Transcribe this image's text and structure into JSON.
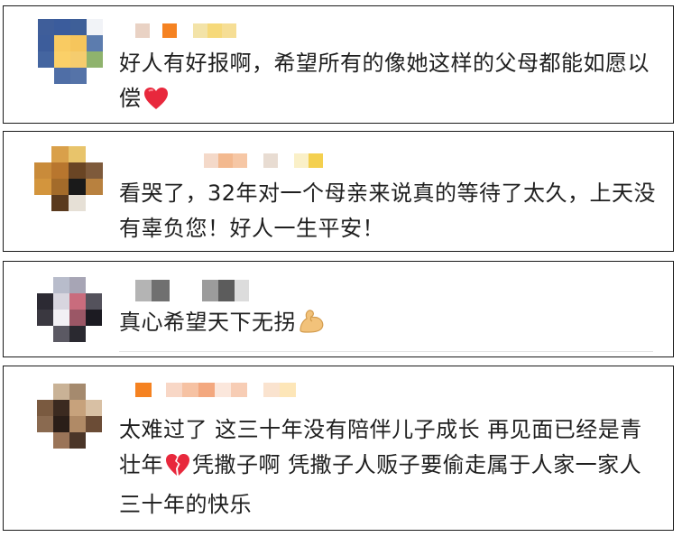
{
  "comments": [
    {
      "text_before": "好人有好报啊，希望所有的像她这样的父母都能如愿以偿",
      "emoji": "red-heart-icon",
      "text_after": ""
    },
    {
      "text_before": "看哭了，32年对一个母亲来说真的等待了太久，上天没有辜负您！好人一生平安！",
      "emoji": "",
      "text_after": ""
    },
    {
      "text_before": "真心希望天下无拐",
      "emoji": "flexed-biceps-icon",
      "text_after": ""
    },
    {
      "text_before": "太难过了 这三十年没有陪伴儿子成长 再见面已经是青壮年",
      "emoji": "broken-heart-icon",
      "text_after": "凭撒子啊 凭撒子人贩子要偷走属于人家一家人三十年的快乐"
    }
  ],
  "colors": {
    "text": "#1f1f1f",
    "border": "#1a1a1a",
    "heart": "#e8283c"
  }
}
